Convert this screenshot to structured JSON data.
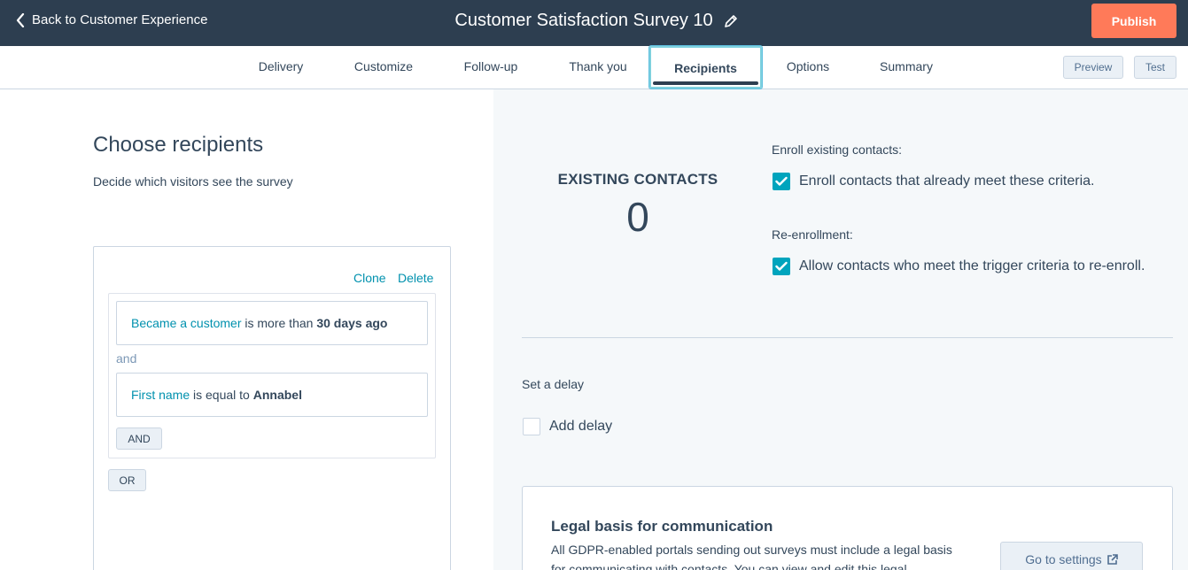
{
  "header": {
    "back_label": "Back to Customer Experience",
    "title": "Customer Satisfaction Survey 10",
    "publish_label": "Publish"
  },
  "tabs": [
    {
      "label": "Delivery"
    },
    {
      "label": "Customize"
    },
    {
      "label": "Follow-up"
    },
    {
      "label": "Thank you"
    },
    {
      "label": "Recipients",
      "active": true
    },
    {
      "label": "Options"
    },
    {
      "label": "Summary"
    }
  ],
  "toolbar": {
    "preview_label": "Preview",
    "test_label": "Test"
  },
  "recipients": {
    "heading": "Choose recipients",
    "subtitle": "Decide which visitors see the survey",
    "clone_label": "Clone",
    "delete_label": "Delete",
    "conditions": [
      {
        "property": "Became a customer",
        "operator": "is more than",
        "value": "30 days ago"
      },
      {
        "property": "First name",
        "operator": "is equal to",
        "value": "Annabel"
      }
    ],
    "and_connector": "and",
    "and_button": "AND",
    "or_button": "OR"
  },
  "existing": {
    "label": "EXISTING CONTACTS",
    "count": "0"
  },
  "enroll": {
    "section_label": "Enroll existing contacts:",
    "checkbox_label": "Enroll contacts that already meet these criteria.",
    "checked": true
  },
  "reenroll": {
    "section_label": "Re-enrollment:",
    "checkbox_label": "Allow contacts who meet the trigger criteria to re-enroll.",
    "checked": true
  },
  "delay": {
    "section_label": "Set a delay",
    "checkbox_label": "Add delay",
    "checked": false
  },
  "legal": {
    "title": "Legal basis for communication",
    "text": "All GDPR-enabled portals sending out surveys must include a legal basis for communicating with contacts. You can view and edit this legal",
    "button_label": "Go to settings"
  },
  "colors": {
    "header_bg": "#2d3e50",
    "publish": "#ff7a59",
    "link": "#0091ae",
    "checkbox": "#00a4bd",
    "panel_bg": "#f5f8fa"
  }
}
